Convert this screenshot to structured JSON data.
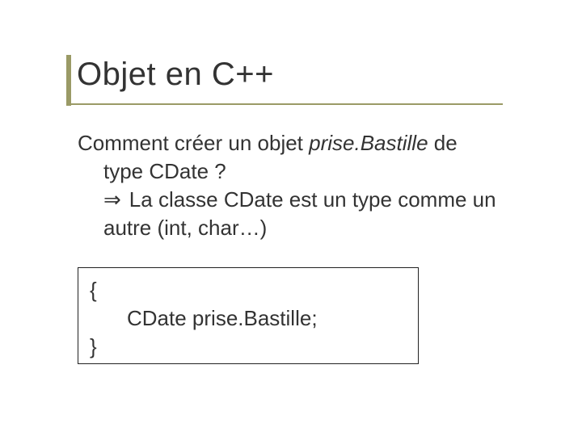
{
  "title": "Objet en C++",
  "body": {
    "line1_a": "Comment créer un objet ",
    "line1_b": "prise.Bastille",
    "line1_c": " de",
    "line2": "type CDate ?",
    "arrow_glyph": "⇒",
    "line3": "La classe CDate est un type comme un",
    "line4": "autre (int, char…)"
  },
  "code": {
    "open_brace": "{",
    "decl_a": "CDate ",
    "decl_b": "prise.Bastille",
    "decl_c": ";",
    "close_brace": "}"
  }
}
